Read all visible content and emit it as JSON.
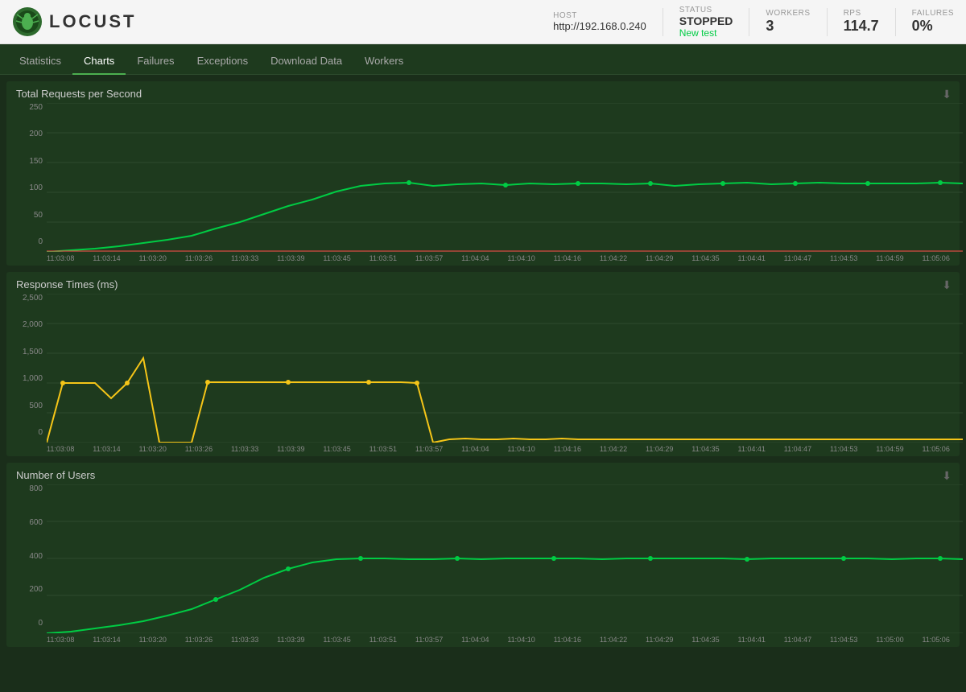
{
  "header": {
    "logo_text": "LOCUST",
    "host_label": "HOST",
    "host_value": "http://192.168.0.240",
    "status_label": "STATUS",
    "status_value": "STOPPED",
    "new_test_label": "New test",
    "workers_label": "WORKERS",
    "workers_value": "3",
    "rps_label": "RPS",
    "rps_value": "114.7",
    "failures_label": "FAILURES",
    "failures_value": "0%"
  },
  "nav": {
    "tabs": [
      {
        "id": "statistics",
        "label": "Statistics",
        "active": false
      },
      {
        "id": "charts",
        "label": "Charts",
        "active": true
      },
      {
        "id": "failures",
        "label": "Failures",
        "active": false
      },
      {
        "id": "exceptions",
        "label": "Exceptions",
        "active": false
      },
      {
        "id": "download_data",
        "label": "Download Data",
        "active": false
      },
      {
        "id": "workers",
        "label": "Workers",
        "active": false
      }
    ]
  },
  "charts": {
    "rps": {
      "title": "Total Requests per Second",
      "y_labels": [
        "250",
        "200",
        "150",
        "100",
        "50",
        "0"
      ],
      "x_labels": [
        "11:03:08",
        "11:03:14",
        "11:03:20",
        "11:03:26",
        "11:03:33",
        "11:03:39",
        "11:03:45",
        "11:03:51",
        "11:03:57",
        "11:04:04",
        "11:04:10",
        "11:04:16",
        "11:04:22",
        "11:04:29",
        "11:04:35",
        "11:04:41",
        "11:04:47",
        "11:04:53",
        "11:04:59",
        "11:05:06"
      ]
    },
    "response": {
      "title": "Response Times (ms)",
      "y_labels": [
        "2,500",
        "2,000",
        "1,500",
        "1,000",
        "500",
        "0"
      ],
      "x_labels": [
        "11:03:08",
        "11:03:14",
        "11:03:20",
        "11:03:26",
        "11:03:33",
        "11:03:39",
        "11:03:45",
        "11:03:51",
        "11:03:57",
        "11:04:04",
        "11:04:10",
        "11:04:16",
        "11:04:22",
        "11:04:29",
        "11:04:35",
        "11:04:41",
        "11:04:47",
        "11:04:53",
        "11:04:59",
        "11:05:06"
      ]
    },
    "users": {
      "title": "Number of Users",
      "y_labels": [
        "800",
        "600",
        "400",
        "200",
        "0"
      ],
      "x_labels": [
        "11:03:08",
        "11:03:14",
        "11:03:20",
        "11:03:26",
        "11:03:33",
        "11:03:39",
        "11:03:45",
        "11:03:51",
        "11:03:57",
        "11:04:04",
        "11:04:10",
        "11:04:16",
        "11:04:22",
        "11:04:29",
        "11:04:35",
        "11:04:41",
        "11:04:47",
        "11:04:53",
        "11:05:00",
        "11:05:06"
      ]
    }
  },
  "icons": {
    "download": "⬇"
  }
}
